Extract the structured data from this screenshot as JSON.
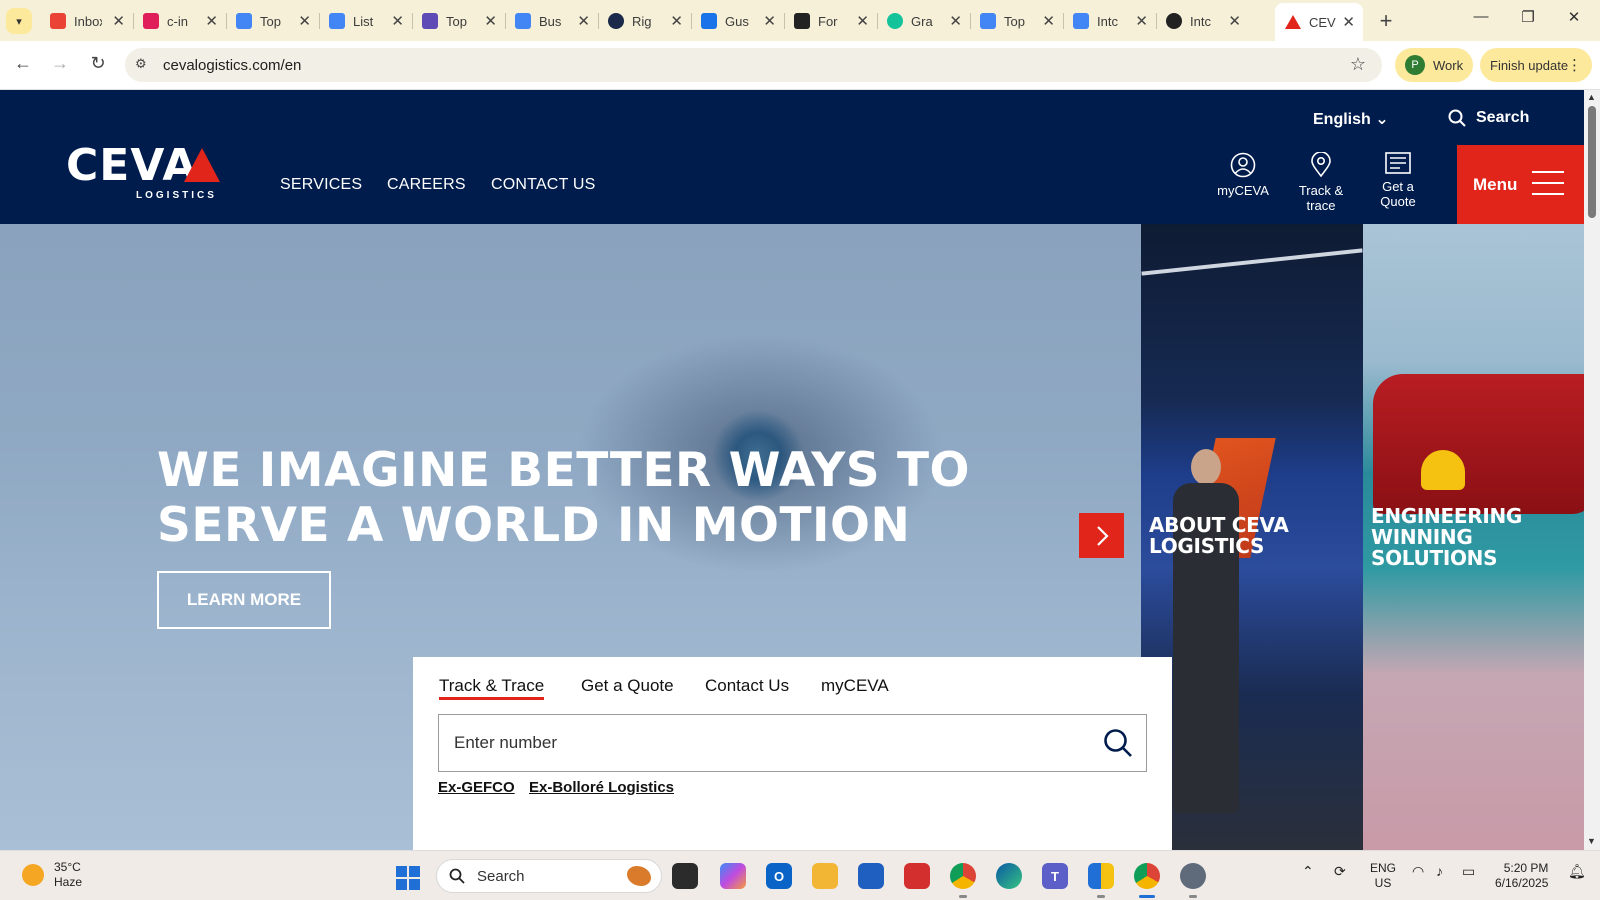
{
  "browser": {
    "tabs": [
      {
        "title": "Inbox",
        "icon": "gmail-icon",
        "color": "#ea4335"
      },
      {
        "title": "c-in",
        "icon": "slack-icon",
        "color": "#e01e5a"
      },
      {
        "title": "Top",
        "icon": "google-docs-icon",
        "color": "#4285f4"
      },
      {
        "title": "List",
        "icon": "google-docs-icon",
        "color": "#4285f4"
      },
      {
        "title": "Top",
        "icon": "play-icon",
        "color": "#5f4bb6"
      },
      {
        "title": "Bus",
        "icon": "google-docs-icon",
        "color": "#4285f4"
      },
      {
        "title": "Rig",
        "icon": "q-icon",
        "color": "#1b2a4a"
      },
      {
        "title": "Gus",
        "icon": "edit-icon",
        "color": "#1a73e8"
      },
      {
        "title": "For",
        "icon": "flower-icon",
        "color": "#222222"
      },
      {
        "title": "Gra",
        "icon": "grammarly-icon",
        "color": "#15c39a"
      },
      {
        "title": "Top",
        "icon": "google-docs-icon",
        "color": "#4285f4"
      },
      {
        "title": "Intc",
        "icon": "google-docs-icon",
        "color": "#4285f4"
      },
      {
        "title": "Intc",
        "icon": "openai-icon",
        "color": "#222222"
      },
      {
        "title": "CEV",
        "icon": "ceva-icon",
        "color": "#e1251b",
        "active": true
      }
    ],
    "url": "cevalogistics.com/en",
    "profile_initial": "P",
    "profile_label": "Work",
    "update_label": "Finish update"
  },
  "header": {
    "logo_word": "CEVA",
    "logo_sub": "LOGISTICS",
    "nav": [
      "SERVICES",
      "CAREERS",
      "CONTACT US"
    ],
    "language": "English",
    "search_label": "Search",
    "quick_links": [
      {
        "label": "myCEVA",
        "icon": "user-circle-icon"
      },
      {
        "label": "Track & trace",
        "icon": "location-pin-icon"
      },
      {
        "label": "Get a Quote",
        "icon": "document-list-icon"
      }
    ],
    "menu_label": "Menu"
  },
  "hero": {
    "title": "WE IMAGINE BETTER WAYS TO SERVE A WORLD IN MOTION",
    "cta": "LEARN MORE"
  },
  "side_cards": [
    {
      "label": "ABOUT CEVA LOGISTICS"
    },
    {
      "label": "ENGINEERING WINNING SOLUTIONS"
    }
  ],
  "tracking": {
    "tabs": [
      "Track & Trace",
      "Get a Quote",
      "Contact Us",
      "myCEVA"
    ],
    "active_tab": 0,
    "placeholder": "Enter number",
    "links": [
      "Ex-GEFCO",
      "Ex-Bolloré Logistics"
    ]
  },
  "taskbar": {
    "weather_temp": "35°C",
    "weather_desc": "Haze",
    "search_placeholder": "Search",
    "lang_line1": "ENG",
    "lang_line2": "US",
    "time": "5:20 PM",
    "date": "6/16/2025"
  },
  "colors": {
    "brand_navy": "#001c4c",
    "brand_red": "#e1251b",
    "chrome_tabbar": "#f6f0d8",
    "chrome_chip": "#fde99b"
  }
}
